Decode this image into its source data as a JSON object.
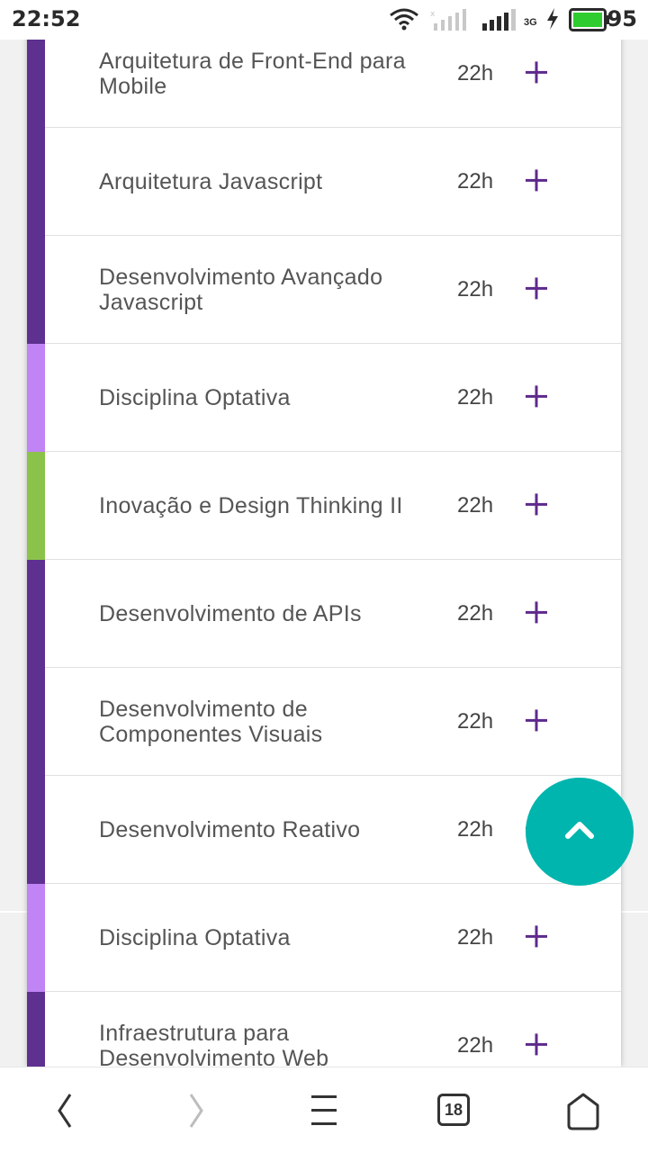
{
  "status_bar": {
    "time": "22:52",
    "network": "3G",
    "battery": "95",
    "icons": [
      "wifi-icon",
      "signal-sim1-icon",
      "signal-sim2-icon",
      "charging-icon",
      "battery-icon"
    ]
  },
  "colors": {
    "purple_dark": "#5e3090",
    "purple_light": "#c084f5",
    "green": "#8bc34a",
    "accent_plus": "#5e2a8c",
    "fab": "#00b5ad"
  },
  "courses": [
    {
      "name": "Arquitetura de Front-End para Mobile",
      "hours": "22h",
      "color": "#5e3090"
    },
    {
      "name": "Arquitetura Javascript",
      "hours": "22h",
      "color": "#5e3090"
    },
    {
      "name": "Desenvolvimento Avançado Javascript",
      "hours": "22h",
      "color": "#5e3090"
    },
    {
      "name": "Disciplina Optativa",
      "hours": "22h",
      "color": "#c084f5"
    },
    {
      "name": "Inovação e Design Thinking II",
      "hours": "22h",
      "color": "#8bc34a"
    },
    {
      "name": "Desenvolvimento de APIs",
      "hours": "22h",
      "color": "#5e3090"
    },
    {
      "name": "Desenvolvimento de Componentes Visuais",
      "hours": "22h",
      "color": "#5e3090"
    },
    {
      "name": "Desenvolvimento Reativo",
      "hours": "22h",
      "color": "#5e3090"
    },
    {
      "name": "Disciplina Optativa",
      "hours": "22h",
      "color": "#c084f5"
    },
    {
      "name": "Infraestrutura para Desenvolvimento Web",
      "hours": "22h",
      "color": "#5e3090"
    }
  ],
  "fab": {
    "icon": "chevron-up-icon"
  },
  "bottom_nav": {
    "tab_count": "18",
    "icons": [
      "back-icon",
      "forward-icon",
      "menu-icon",
      "tabs-icon",
      "home-icon"
    ]
  }
}
